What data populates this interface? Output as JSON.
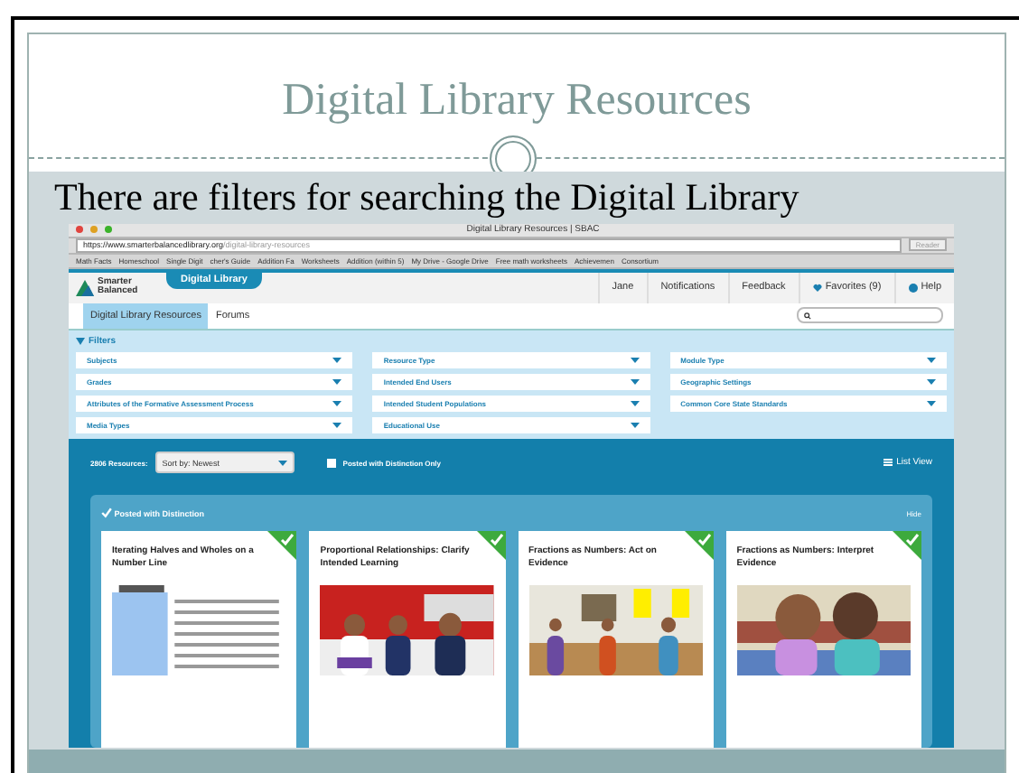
{
  "slide": {
    "title": "Digital Library Resources",
    "caption": "There are filters for searching the Digital Library"
  },
  "browser": {
    "window_title": "Digital Library Resources | SBAC",
    "url_host": "https://www.smarterbalancedlibrary.org",
    "url_path": "/digital-library-resources",
    "reader": "Reader",
    "bookmarks": [
      "Math Facts",
      "Homeschool",
      "Single Digit",
      "cher's Guide",
      "Addition Fa",
      "Worksheets",
      "Addition (within 5)",
      "My Drive - Google Drive",
      "Free math worksheets",
      "Achievemen",
      "Consortium"
    ]
  },
  "site": {
    "logo": [
      "Smarter",
      "Balanced"
    ],
    "brand_tab": "Digital Library",
    "nav": [
      "Jane",
      "Notifications",
      "Feedback",
      "Favorites (9)",
      "Help"
    ],
    "tabs": [
      {
        "label": "Digital Library Resources",
        "selected": true
      },
      {
        "label": "Forums",
        "selected": false
      }
    ],
    "filters": {
      "heading": "Filters",
      "expanded": true,
      "items": [
        "Subjects",
        "Resource Type",
        "Module Type",
        "Grades",
        "Intended End Users",
        "Geographic Settings",
        "Attributes of the Formative Assessment Process",
        "Intended Student Populations",
        "Common Core State Standards",
        "Media Types",
        "Educational Use"
      ]
    },
    "results": {
      "count": "2806 Resources:",
      "sort": "Sort by: Newest",
      "distinction_only": {
        "label": "Posted with Distinction Only",
        "checked": false
      },
      "list_view": "List View"
    },
    "panel": {
      "heading": "Posted with Distinction",
      "hide": "Hide",
      "cards": [
        {
          "title": "Iterating Halves and Wholes on a Number Line",
          "distinguished": true,
          "kind": "document"
        },
        {
          "title": "Proportional Relationships: Clarify Intended Learning",
          "distinguished": true,
          "kind": "classroom"
        },
        {
          "title": "Fractions as Numbers: Act on Evidence",
          "distinguished": true,
          "kind": "room"
        },
        {
          "title": "Fractions as Numbers: Interpret Evidence",
          "distinguished": true,
          "kind": "cartoon"
        }
      ]
    }
  }
}
